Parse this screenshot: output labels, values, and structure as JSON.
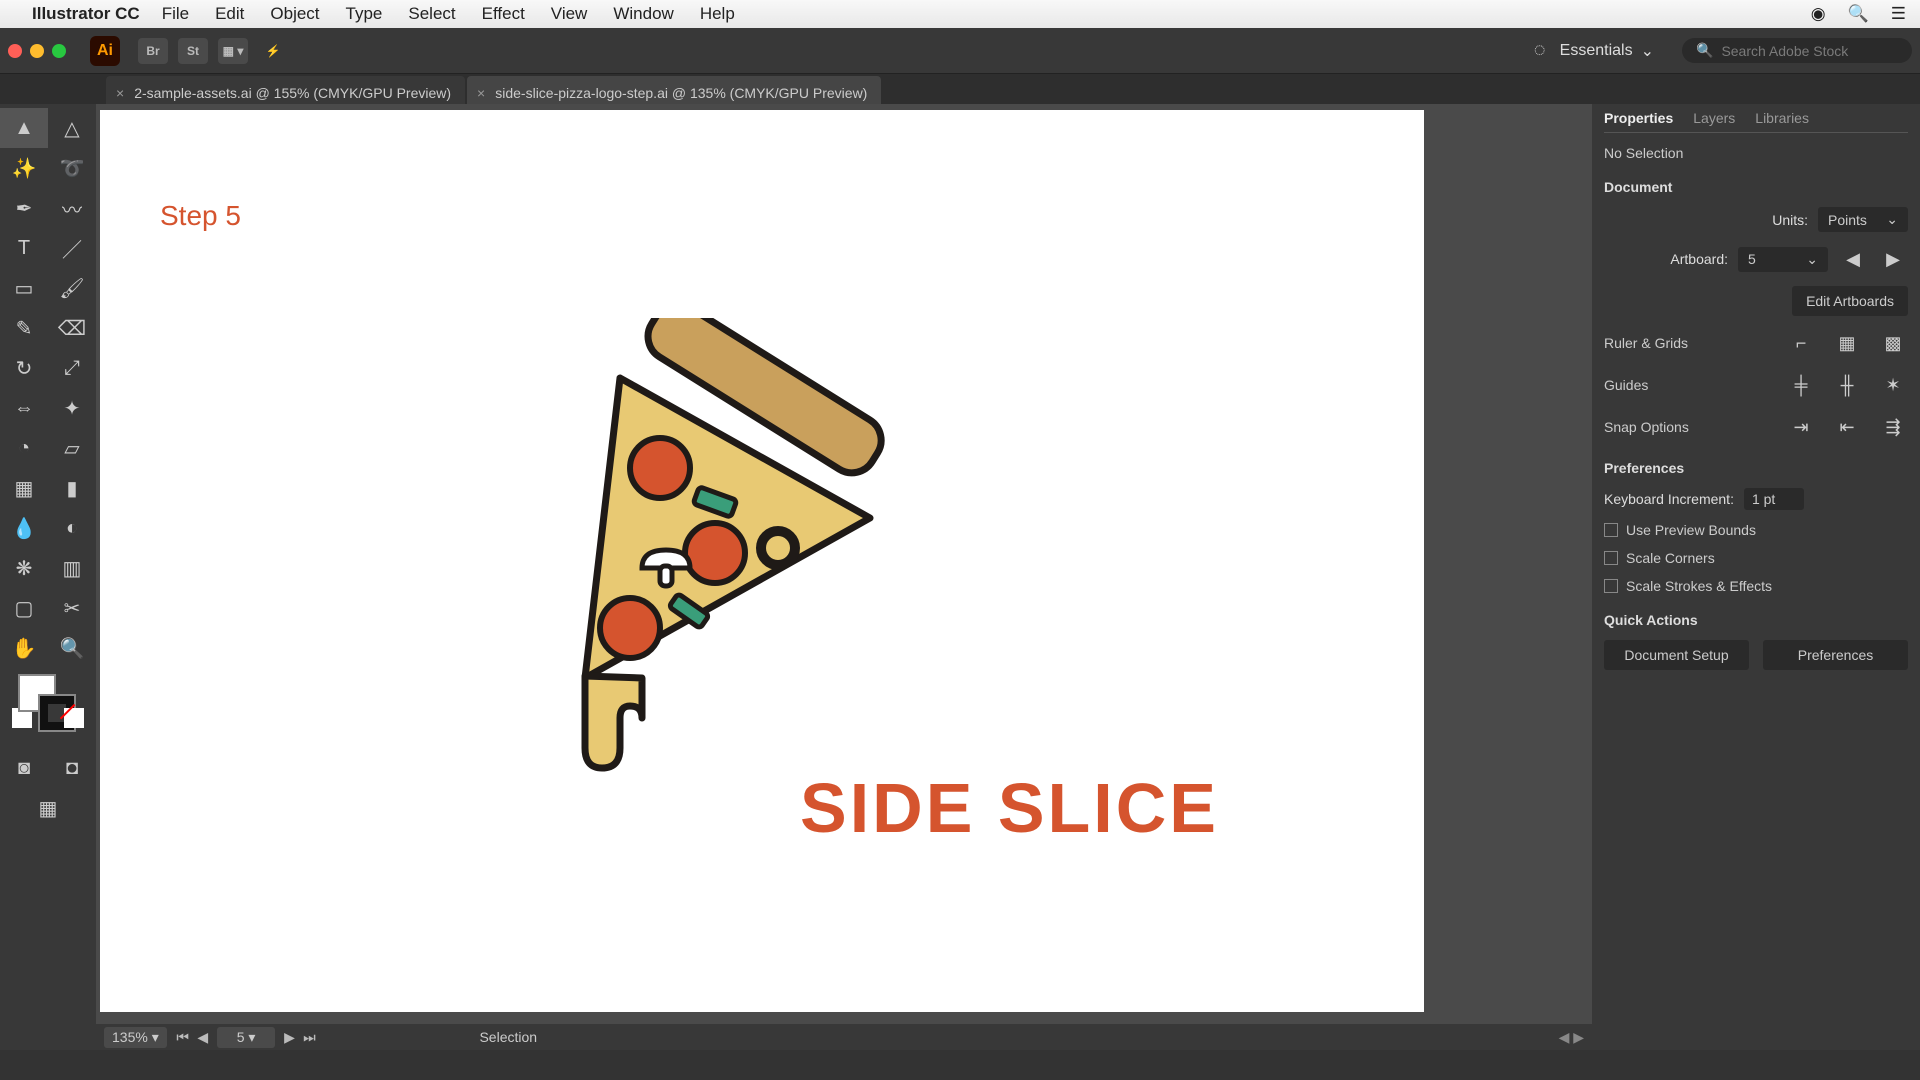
{
  "menubar": {
    "app_name": "Illustrator CC",
    "items": [
      "File",
      "Edit",
      "Object",
      "Type",
      "Select",
      "Effect",
      "View",
      "Window",
      "Help"
    ]
  },
  "controlbar": {
    "logo": "Ai",
    "buttons": [
      "Br",
      "St"
    ],
    "workspace_label": "Essentials",
    "search_placeholder": "Search Adobe Stock"
  },
  "tabs": [
    {
      "label": "2-sample-assets.ai @ 155% (CMYK/GPU Preview)",
      "active": false
    },
    {
      "label": "side-slice-pizza-logo-step.ai @ 135% (CMYK/GPU Preview)",
      "active": true
    }
  ],
  "canvas": {
    "step_label": "Step 5",
    "brand_text": "SIDE SLICE"
  },
  "statusbar": {
    "zoom": "135%",
    "artboard": "5",
    "tool": "Selection"
  },
  "panel": {
    "tabs": [
      "Properties",
      "Layers",
      "Libraries"
    ],
    "selection_label": "No Selection",
    "section_document": "Document",
    "units_label": "Units:",
    "units_value": "Points",
    "artboard_label": "Artboard:",
    "artboard_value": "5",
    "edit_artboards_label": "Edit Artboards",
    "ruler_grids_label": "Ruler & Grids",
    "guides_label": "Guides",
    "snap_label": "Snap Options",
    "preferences_label": "Preferences",
    "keyboard_increment_label": "Keyboard Increment:",
    "keyboard_increment_value": "1 pt",
    "chk_preview_bounds": "Use Preview Bounds",
    "chk_scale_corners": "Scale Corners",
    "chk_scale_strokes": "Scale Strokes & Effects",
    "quick_actions_label": "Quick Actions",
    "document_setup_label": "Document Setup",
    "preferences_btn_label": "Preferences"
  }
}
